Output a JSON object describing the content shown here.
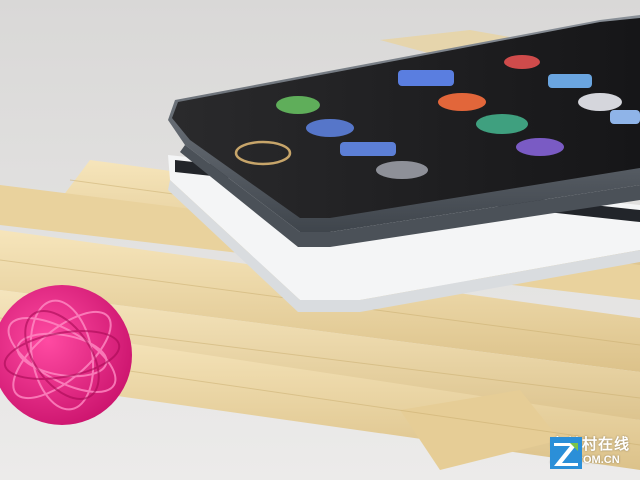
{
  "scene": {
    "description_colors": {
      "background": "#e6e4e2",
      "bamboo": "#efd9a6",
      "yarn_ball": "#e8197c",
      "front_phone_frame": "#5c636b",
      "back_phone_body": "#f4f5f6"
    }
  },
  "app_icons": [
    {
      "name": "green-app-icon",
      "color": "#5fae5a"
    },
    {
      "name": "blue-app-icon",
      "color": "#5676c9"
    },
    {
      "name": "orange-app-icon",
      "color": "#e2663a"
    },
    {
      "name": "teal-app-icon",
      "color": "#3fa07f"
    },
    {
      "name": "settings-app-icon",
      "color": "#8e9098"
    },
    {
      "name": "puzzle-app-icon",
      "color": "#5c7fd6"
    },
    {
      "name": "purple-app-icon",
      "color": "#7a5bc4"
    },
    {
      "name": "lightblue-app-icon",
      "color": "#6aa5e0"
    }
  ],
  "watermark": {
    "cn": "中关村在线",
    "en": "ZOL.COM.CN",
    "logo_color": "#2b8fd8",
    "logo_accent": "#7cc34a"
  }
}
